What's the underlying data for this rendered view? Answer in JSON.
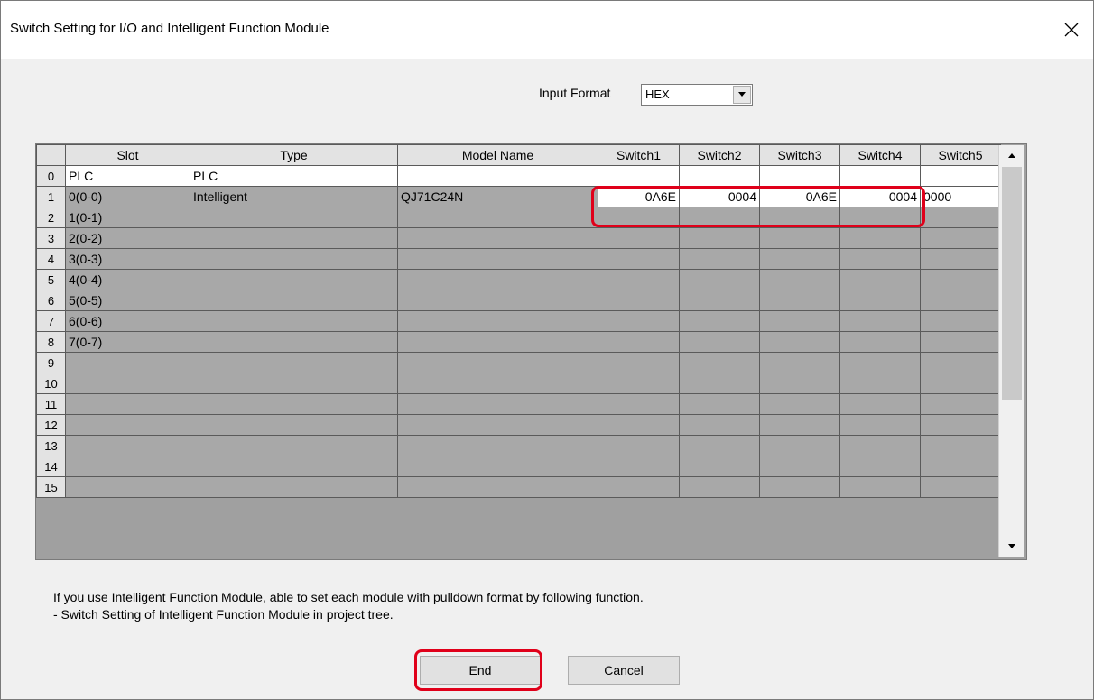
{
  "window": {
    "title": "Switch Setting for I/O and Intelligent Function Module"
  },
  "icons": {
    "close": "close-icon",
    "dropdown": "chevron-down-icon",
    "scroll_up": "scroll-up-arrow-icon",
    "scroll_down": "scroll-down-arrow-icon"
  },
  "input_format": {
    "label": "Input Format",
    "value": "HEX"
  },
  "table": {
    "columns": [
      "",
      "Slot",
      "Type",
      "Model Name",
      "Switch1",
      "Switch2",
      "Switch3",
      "Switch4",
      "Switch5"
    ],
    "rows": [
      {
        "num": "0",
        "slot": "PLC",
        "type": "PLC",
        "model": "",
        "sw1": "",
        "sw2": "",
        "sw3": "",
        "sw4": "",
        "sw5": ""
      },
      {
        "num": "1",
        "slot": "0(0-0)",
        "type": "Intelligent",
        "model": "QJ71C24N",
        "sw1": "0A6E",
        "sw2": "0004",
        "sw3": "0A6E",
        "sw4": "0004",
        "sw5": "0000"
      },
      {
        "num": "2",
        "slot": "1(0-1)",
        "type": "",
        "model": "",
        "sw1": "",
        "sw2": "",
        "sw3": "",
        "sw4": "",
        "sw5": ""
      },
      {
        "num": "3",
        "slot": "2(0-2)",
        "type": "",
        "model": "",
        "sw1": "",
        "sw2": "",
        "sw3": "",
        "sw4": "",
        "sw5": ""
      },
      {
        "num": "4",
        "slot": "3(0-3)",
        "type": "",
        "model": "",
        "sw1": "",
        "sw2": "",
        "sw3": "",
        "sw4": "",
        "sw5": ""
      },
      {
        "num": "5",
        "slot": "4(0-4)",
        "type": "",
        "model": "",
        "sw1": "",
        "sw2": "",
        "sw3": "",
        "sw4": "",
        "sw5": ""
      },
      {
        "num": "6",
        "slot": "5(0-5)",
        "type": "",
        "model": "",
        "sw1": "",
        "sw2": "",
        "sw3": "",
        "sw4": "",
        "sw5": ""
      },
      {
        "num": "7",
        "slot": "6(0-6)",
        "type": "",
        "model": "",
        "sw1": "",
        "sw2": "",
        "sw3": "",
        "sw4": "",
        "sw5": ""
      },
      {
        "num": "8",
        "slot": "7(0-7)",
        "type": "",
        "model": "",
        "sw1": "",
        "sw2": "",
        "sw3": "",
        "sw4": "",
        "sw5": ""
      },
      {
        "num": "9",
        "slot": "",
        "type": "",
        "model": "",
        "sw1": "",
        "sw2": "",
        "sw3": "",
        "sw4": "",
        "sw5": ""
      },
      {
        "num": "10",
        "slot": "",
        "type": "",
        "model": "",
        "sw1": "",
        "sw2": "",
        "sw3": "",
        "sw4": "",
        "sw5": ""
      },
      {
        "num": "11",
        "slot": "",
        "type": "",
        "model": "",
        "sw1": "",
        "sw2": "",
        "sw3": "",
        "sw4": "",
        "sw5": ""
      },
      {
        "num": "12",
        "slot": "",
        "type": "",
        "model": "",
        "sw1": "",
        "sw2": "",
        "sw3": "",
        "sw4": "",
        "sw5": ""
      },
      {
        "num": "13",
        "slot": "",
        "type": "",
        "model": "",
        "sw1": "",
        "sw2": "",
        "sw3": "",
        "sw4": "",
        "sw5": ""
      },
      {
        "num": "14",
        "slot": "",
        "type": "",
        "model": "",
        "sw1": "",
        "sw2": "",
        "sw3": "",
        "sw4": "",
        "sw5": ""
      },
      {
        "num": "15",
        "slot": "",
        "type": "",
        "model": "",
        "sw1": "",
        "sw2": "",
        "sw3": "",
        "sw4": "",
        "sw5": ""
      }
    ]
  },
  "info": {
    "line1": "If you use Intelligent Function Module, able to set each module with pulldown format by following function.",
    "line2": "- Switch Setting of Intelligent Function Module in project tree."
  },
  "buttons": {
    "end": "End",
    "cancel": "Cancel"
  },
  "colors": {
    "highlight": "#e0001a",
    "grid_gray": "#a8a8a8",
    "header_gray": "#e3e3e3"
  }
}
